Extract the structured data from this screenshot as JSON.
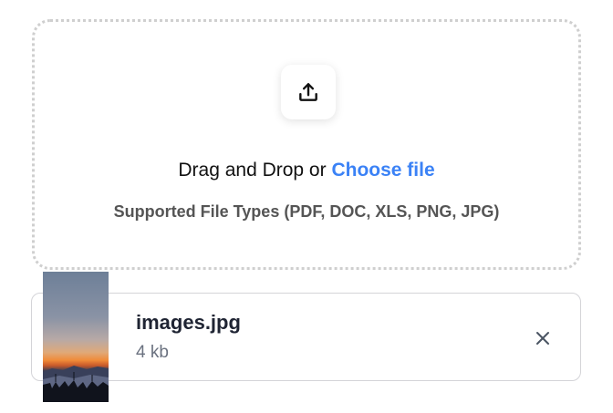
{
  "uploader": {
    "upload_icon": "upload-icon",
    "drop_text": "Drag and Drop or ",
    "choose_label": "Choose file",
    "supported_types": "Supported File Types (PDF, DOC, XLS, PNG, JPG)",
    "accent_color": "#3b82f6"
  },
  "file": {
    "name": "images.jpg",
    "size": "4 kb",
    "thumbnail": "sunset-landscape-thumbnail",
    "remove_icon": "close-icon"
  }
}
